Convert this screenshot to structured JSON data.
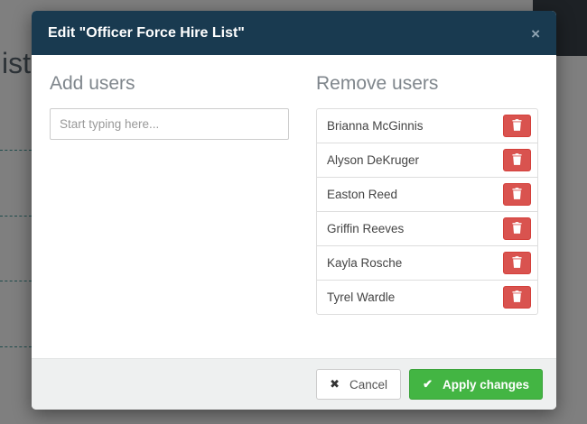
{
  "background": {
    "partial_heading": "ists"
  },
  "modal": {
    "title": "Edit \"Officer Force Hire List\"",
    "add_users": {
      "heading": "Add users",
      "input_value": "",
      "input_placeholder": "Start typing here..."
    },
    "remove_users": {
      "heading": "Remove users",
      "users": [
        "Brianna McGinnis",
        "Alyson DeKruger",
        "Easton Reed",
        "Griffin Reeves",
        "Kayla Rosche",
        "Tyrel Wardle"
      ]
    },
    "footer": {
      "cancel_label": "Cancel",
      "apply_label": "Apply changes"
    }
  },
  "icons": {
    "close": "×",
    "cancel": "✖",
    "apply": "✔",
    "delete": "trash"
  },
  "colors": {
    "header_bg": "#193a50",
    "danger": "#d9534f",
    "success": "#43b543",
    "footer_bg": "#eef0f0",
    "overlay": "rgba(0,0,0,0.5)"
  }
}
